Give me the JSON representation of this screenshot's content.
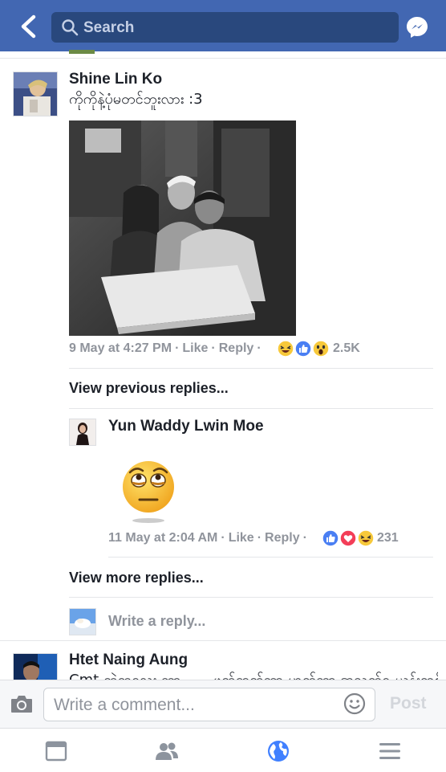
{
  "header": {
    "search_placeholder": "Search"
  },
  "comment1": {
    "author": "Shine Lin Ko",
    "text": "ကိုကိုနဲ့ပုံမတင်ဘူးလား :3",
    "time": "9 May at 4:27 PM",
    "like_label": "Like",
    "reply_label": "Reply",
    "reaction_count": "2.5K"
  },
  "view_previous": "View previous replies...",
  "reply1": {
    "author": "Yun Waddy Lwin Moe",
    "time": "11 May at 2:04 AM",
    "like_label": "Like",
    "reply_label": "Reply",
    "reaction_count": "231"
  },
  "view_more": "View more replies...",
  "reply_input_placeholder": "Write a reply...",
  "comment2": {
    "author": "Htet Naing Aung",
    "text": "Cmt တဲ့ကလေး ဘာ ..... ဖတ်ထက်ဘာ ဟုတ်ဘာ အသက်ရ ယန်းတစ်"
  },
  "composer": {
    "placeholder": "Write a comment...",
    "post_label": "Post"
  },
  "colors": {
    "brand": "#4267b2",
    "search_bg": "#29487d",
    "active_tab": "#4080ff"
  }
}
